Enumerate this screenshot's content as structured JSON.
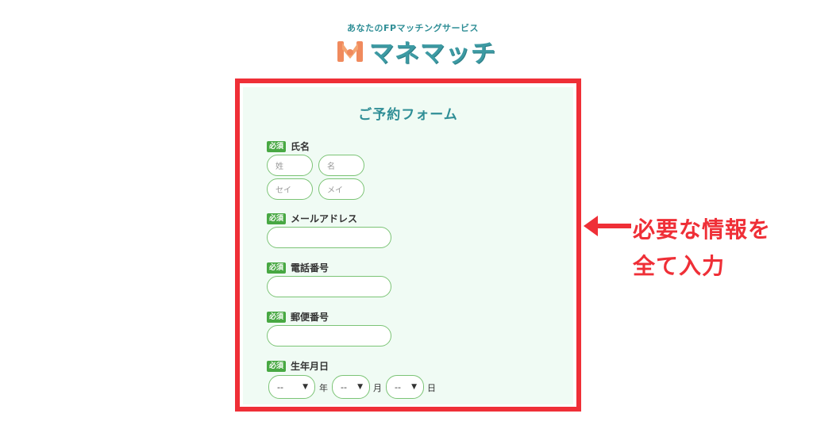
{
  "header": {
    "tagline": "あなたのFPマッチングサービス",
    "brand": "マネマッチ"
  },
  "form": {
    "title": "ご予約フォーム",
    "required_badge": "必須",
    "name": {
      "label": "氏名",
      "last_placeholder": "姓",
      "first_placeholder": "名",
      "last_kana_placeholder": "セイ",
      "first_kana_placeholder": "メイ"
    },
    "email": {
      "label": "メールアドレス",
      "value": ""
    },
    "phone": {
      "label": "電話番号",
      "value": ""
    },
    "postal": {
      "label": "郵便番号",
      "value": ""
    },
    "birthdate": {
      "label": "生年月日",
      "year_value": "--",
      "month_value": "--",
      "day_value": "--",
      "year_unit": "年",
      "month_unit": "月",
      "day_unit": "日"
    }
  },
  "callout": {
    "line1": "必要な情報を",
    "line2": "全て入力"
  },
  "colors": {
    "accent_teal": "#2f8e96",
    "required_green": "#48a843",
    "input_border": "#7cc476",
    "highlight_red": "#ef2f37",
    "form_bg": "#f0fbf4"
  }
}
